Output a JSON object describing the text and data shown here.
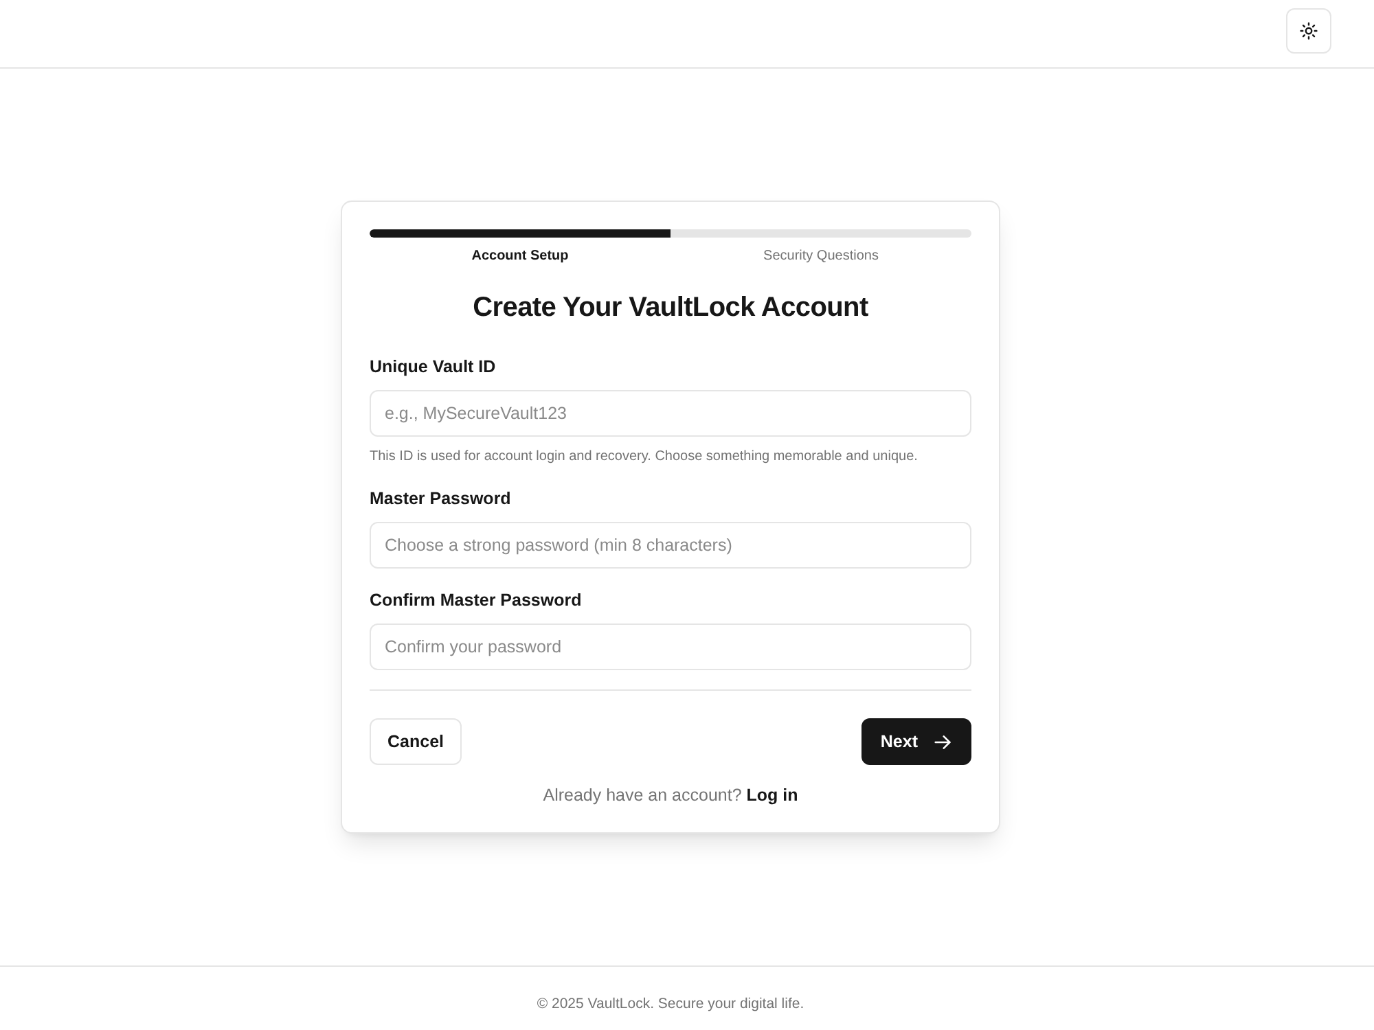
{
  "progress": {
    "level": 0.5,
    "steps": [
      {
        "label": "Account Setup",
        "selected": true
      },
      {
        "label": "Security Questions",
        "selected": false
      }
    ]
  },
  "title": "Create Your VaultLock Account",
  "fields": [
    {
      "label": "Unique Vault ID",
      "placeholder": "e.g., MySecureVault123",
      "hint": "This ID is used for account login and recovery. Choose something memorable and unique."
    },
    {
      "label": "Master Password",
      "placeholder": "Choose a strong password (min 8 characters)"
    },
    {
      "label": "Confirm Master Password",
      "placeholder": "Confirm your password"
    }
  ],
  "buttons": [
    {
      "label": "Cancel",
      "kind": "secondary"
    },
    {
      "label": "Next",
      "kind": "primary"
    }
  ],
  "login_prompt": {
    "text": "Already have an account?",
    "link": "Log in"
  },
  "footer": "© 2025 VaultLock. Secure your digital life."
}
